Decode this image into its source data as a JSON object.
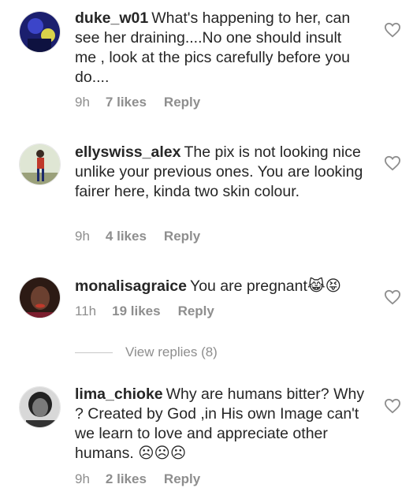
{
  "comments": [
    {
      "username": "duke_w01",
      "text": "What's happening to her, can see her draining....No one should insult me , look at the pics carefully before you do....",
      "time": "9h",
      "likes": "7 likes",
      "reply": "Reply"
    },
    {
      "username": "ellyswiss_alex",
      "text": "The pix is not looking nice unlike your previous ones. You are looking fairer here, kinda two skin colour.",
      "time": "9h",
      "likes": "4 likes",
      "reply": "Reply"
    },
    {
      "username": "monalisagraice",
      "text": "You are pregnant😹😝",
      "time": "11h",
      "likes": "19 likes",
      "reply": "Reply"
    },
    {
      "username": "lima_chioke",
      "text": "Why are humans  bitter? Why ? Created  by God ,in His own Image can't we learn to love and appreciate other humans. ☹☹☹",
      "time": "9h",
      "likes": "2 likes",
      "reply": "Reply"
    }
  ],
  "view_replies": "View replies (8)",
  "colors": {
    "text": "#262626",
    "meta": "#8e8e8e",
    "divider": "#c7c7c7"
  }
}
